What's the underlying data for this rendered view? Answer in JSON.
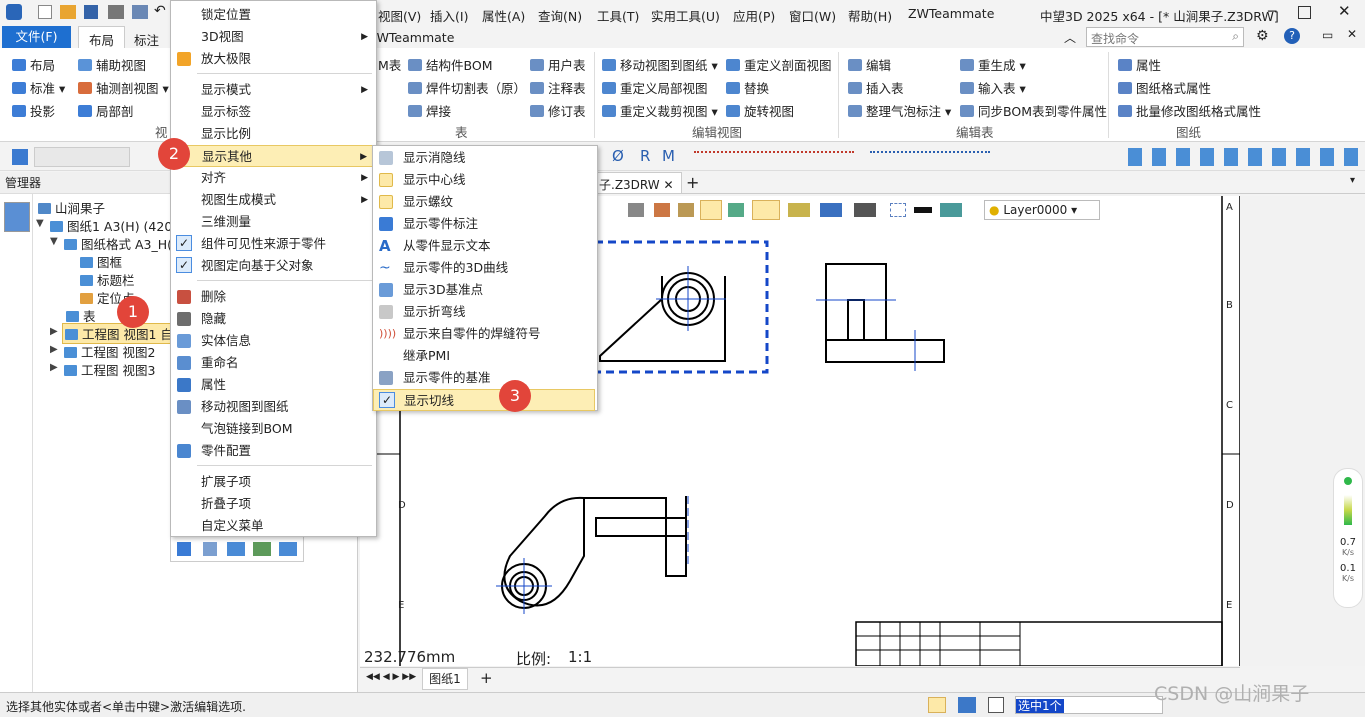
{
  "titlebar": {
    "menus": [
      "视图(V)",
      "插入(I)",
      "属性(A)",
      "查询(N)",
      "工具(T)",
      "实用工具(U)",
      "应用(P)",
      "窗口(W)",
      "帮助(H)",
      "ZWTeammate"
    ],
    "title": "中望3D 2025 x64 - [* 山涧果子.Z3DRW]",
    "search_placeholder": "查找命令"
  },
  "ribbon_tabs": {
    "file": "文件(F)",
    "layout": "布局",
    "annotate": "标注",
    "teammate": "ZWTeammate"
  },
  "ribbon": {
    "left": [
      "布局",
      "辅助视图",
      "标准",
      "轴测剖视图",
      "投影",
      "局部剖"
    ],
    "left_group": "视",
    "tbl_a": [
      "M表"
    ],
    "table_items": [
      "结构件BOM",
      "焊件切割表（原）",
      "焊接",
      "用户表",
      "注释表",
      "修订表"
    ],
    "table_group": "表",
    "edit_view": [
      "移动视图到图纸",
      "重定义剖面视图",
      "重定义局部视图",
      "替换",
      "重定义裁剪视图",
      "旋转视图"
    ],
    "edit_view_group": "编辑视图",
    "edit_table": [
      "编辑",
      "重生成",
      "插入表",
      "输入表",
      "整理气泡标注",
      "同步BOM表到零件属性"
    ],
    "edit_table_group": "编辑表",
    "drawing": [
      "属性",
      "图纸格式属性",
      "批量修改图纸格式属性"
    ],
    "drawing_group": "图纸"
  },
  "manager": {
    "title": "管理器",
    "tree": [
      "山涧果子",
      "图纸1 A3(H) (420.00",
      "图纸格式 A3_H(C",
      "图框",
      "标题栏",
      "定位点",
      "表",
      "工程图 视图1 自动",
      "工程图 视图2",
      "工程图 视图3"
    ]
  },
  "doc_tab": "子.Z3DRW",
  "layer": "Layer0000",
  "ctx_main": [
    "锁定位置",
    "3D视图",
    "放大极限",
    "显示模式",
    "显示标签",
    "显示比例",
    "显示其他",
    "对齐",
    "视图生成模式",
    "三维测量",
    "组件可见性来源于零件",
    "视图定向基于父对象",
    "删除",
    "隐藏",
    "实体信息",
    "重命名",
    "属性",
    "移动视图到图纸",
    "气泡链接到BOM",
    "零件配置",
    "扩展子项",
    "折叠子项",
    "自定义菜单"
  ],
  "ctx_sub": [
    "显示消隐线",
    "显示中心线",
    "显示螺纹",
    "显示零件标注",
    "从零件显示文本",
    "显示零件的3D曲线",
    "显示3D基准点",
    "显示折弯线",
    "显示来自零件的焊缝符号",
    "继承PMI",
    "显示零件的基准",
    "显示切线"
  ],
  "badges": [
    "1",
    "2",
    "3"
  ],
  "border_labels": [
    "A",
    "B",
    "C",
    "D",
    "E"
  ],
  "border_labels_left": [
    "D",
    "E"
  ],
  "canvas": {
    "measure": "232.776mm",
    "scale_label": "比例:",
    "scale_value": "1:1"
  },
  "sheet_tab": "图纸1",
  "status": {
    "hint": "选择其他实体或者<单击中键>激活编辑选项.",
    "selected": "选中1个",
    "watermark": "CSDN @山涧果子"
  },
  "speed": {
    "up": "0.7",
    "up_unit": "K/s",
    "down": "0.1",
    "down_unit": "K/s"
  },
  "colors": {
    "accent": "#1e6fd0",
    "badge": "#e2453a",
    "highlight": "#fdeeb5",
    "selection": "#1447c8"
  }
}
